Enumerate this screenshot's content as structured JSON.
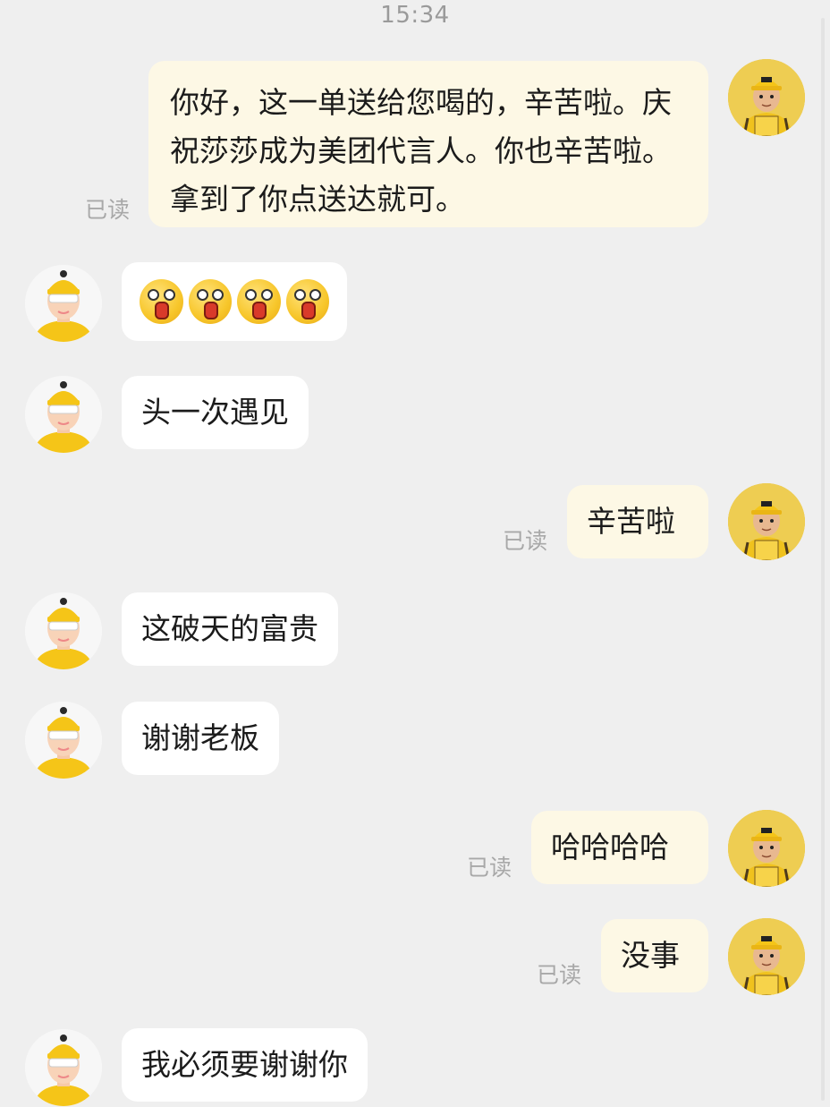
{
  "status_bar": {
    "time": "15:34"
  },
  "colors": {
    "outgoing_bubble": "#fdf8e5",
    "incoming_bubble": "#ffffff",
    "background": "#efefef",
    "read_text": "#a8a8a8"
  },
  "messages": [
    {
      "direction": "out",
      "text": "你好，这一单送给您喝的，辛苦啦。庆祝莎莎成为美团代言人。你也辛苦啦。拿到了你点送达就可。",
      "status": "已读"
    },
    {
      "direction": "in",
      "content_type": "emoji",
      "emoji": "scream-emoji",
      "count": 4
    },
    {
      "direction": "in",
      "text": "头一次遇见"
    },
    {
      "direction": "out",
      "text": "辛苦啦",
      "status": "已读"
    },
    {
      "direction": "in",
      "text": "这破天的富贵"
    },
    {
      "direction": "in",
      "text": "谢谢老板"
    },
    {
      "direction": "out",
      "text": "哈哈哈哈",
      "status": "已读"
    },
    {
      "direction": "out",
      "text": "没事",
      "status": "已读"
    },
    {
      "direction": "in",
      "text": "我必须要谢谢你"
    }
  ]
}
